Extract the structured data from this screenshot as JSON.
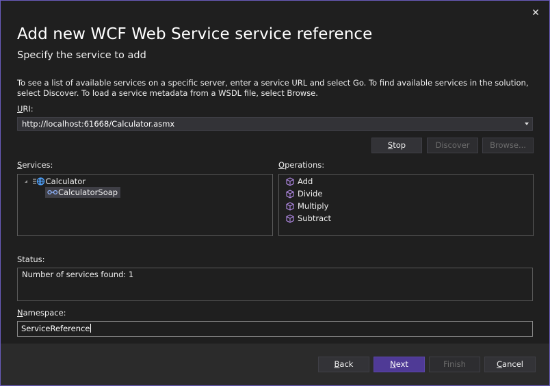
{
  "dialog": {
    "title": "Add new WCF Web Service service reference",
    "subtitle": "Specify the service to add",
    "description": "To see a list of available services on a specific server, enter a service URL and select Go. To find available services in the solution, select Discover. To load a service metadata from a WSDL file, select Browse."
  },
  "uri": {
    "label_key": "U",
    "label_rest": "RI:",
    "value": "http://localhost:61668/Calculator.asmx"
  },
  "buttons": {
    "stop_key": "S",
    "stop_rest": "top",
    "discover": "Discover",
    "browse": "Browse..."
  },
  "services": {
    "label_key": "S",
    "label_rest": "ervices:",
    "root": "Calculator",
    "child": "CalculatorSoap"
  },
  "operations": {
    "label_key": "O",
    "label_rest": "perations:",
    "items": [
      "Add",
      "Divide",
      "Multiply",
      "Subtract"
    ]
  },
  "status": {
    "label": "Status:",
    "text": "Number of services found: 1"
  },
  "namespace": {
    "label_key": "N",
    "label_rest": "amespace:",
    "value": "ServiceReference"
  },
  "footer": {
    "back_key": "B",
    "back_rest": "ack",
    "next_key": "N",
    "next_rest": "ext",
    "finish": "Finish",
    "cancel_key": "C",
    "cancel_rest": "ancel"
  },
  "colors": {
    "accent": "#4f3a96",
    "background": "#1f1f1f",
    "operation_icon": "#b48be8"
  },
  "icons": {
    "close": "close-icon",
    "service": "globe-icon",
    "endpoint": "endpoint-icon",
    "operation": "cube-icon"
  }
}
